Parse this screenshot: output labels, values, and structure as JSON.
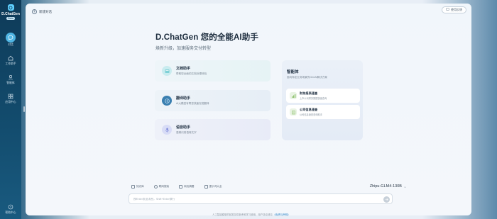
{
  "sidebar": {
    "brand": {
      "name": "D.ChatGen",
      "badge": "Beta"
    },
    "items": [
      {
        "label": "对话",
        "icon": "chat-bubble-icon",
        "active": true
      },
      {
        "label": "工作助手",
        "icon": "home-icon",
        "active": false
      },
      {
        "label": "智能体",
        "icon": "robot-icon",
        "active": false
      },
      {
        "label": "应用中心",
        "icon": "grid-icon",
        "active": false
      }
    ],
    "bottom": {
      "label": "帮助中心",
      "icon": "help-icon"
    }
  },
  "header": {
    "new_chat_label": "新建对话",
    "feedback_label": "使用反馈"
  },
  "hero": {
    "title": "D.ChatGen 您的全能AI助手",
    "subtitle": "焕新升级，加速服务交付转型"
  },
  "assistants": [
    {
      "title": "文档助手",
      "desc": "帮助您全面的文档处理体验",
      "icon": "document-icon"
    },
    {
      "title": "翻译助手",
      "desc": "AI大模型有帮您快速完成翻译",
      "icon": "translate-icon"
    },
    {
      "title": "语音助手",
      "desc": "高精识别语转文字",
      "icon": "microphone-icon"
    }
  ],
  "bureau": {
    "title": "智能体",
    "desc": "面向特定业务场景的GenAI解决方案",
    "items": [
      {
        "title": "财务报表速查",
        "desc": "上市公司财务数据快速查询",
        "icon": "finance-icon"
      },
      {
        "title": "公司信息速查",
        "desc": "公司信息速查查询助手",
        "icon": "company-icon"
      }
    ]
  },
  "toolbar": {
    "tools": [
      {
        "label": "知识库",
        "icon": "book-icon"
      },
      {
        "label": "联网搜索",
        "icon": "globe-icon"
      },
      {
        "label": "网页摘要",
        "icon": "webpage-icon"
      },
      {
        "label": "提示词大全",
        "icon": "prompt-icon"
      }
    ],
    "model": "Zhipu-GLM4-130B"
  },
  "input": {
    "placeholder": "按Enter发送消息，Shift+Enter换行"
  },
  "disclaimer": {
    "text": "人工智能模型的回答仅供参考和学习使用，用户协议请见",
    "link": "《免责与声明》"
  },
  "colors": {
    "sidebar_bg": "#0e3a58",
    "accent": "#4fb5e3",
    "link": "#2f86c9"
  }
}
